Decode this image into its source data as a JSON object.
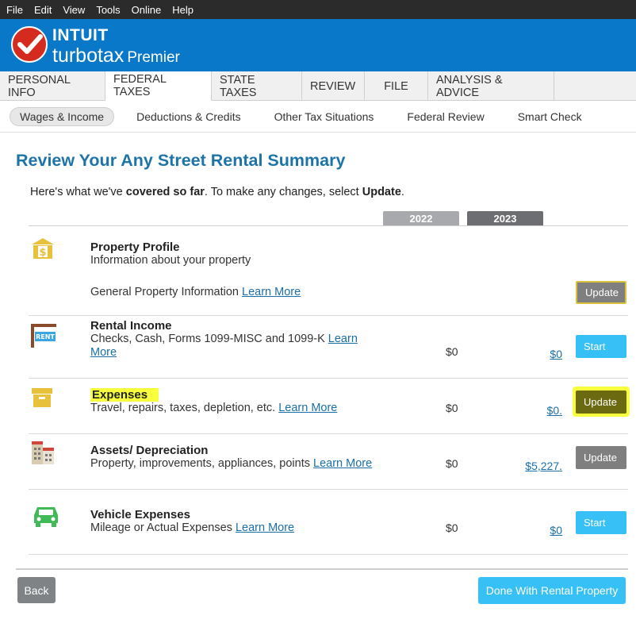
{
  "menu": [
    "File",
    "Edit",
    "View",
    "Tools",
    "Online",
    "Help"
  ],
  "brand": {
    "intuit": "INTUIT",
    "turbotax": "turbotax",
    "edition": "Premier"
  },
  "tabs": [
    "PERSONAL INFO",
    "FEDERAL TAXES",
    "STATE TAXES",
    "REVIEW",
    "FILE",
    "ANALYSIS & ADVICE"
  ],
  "subtabs": [
    "Wages & Income",
    "Deductions & Credits",
    "Other Tax Situations",
    "Federal Review",
    "Smart Check"
  ],
  "page": {
    "title": "Review Your Any Street Rental Summary",
    "intro_pre": "Here's what we've ",
    "intro_bold": "covered so far",
    "intro_mid": ". To make any changes, select ",
    "intro_update": "Update",
    "intro_end": "."
  },
  "years": {
    "prior": "2022",
    "current": "2023"
  },
  "rows": [
    {
      "title": "Property Profile",
      "desc": "Information about your property",
      "sub": "General Property Information",
      "link": "Learn More",
      "button": "Update"
    },
    {
      "title": "Rental Income",
      "desc": "Checks, Cash, Forms 1099-MISC and 1099-K",
      "link": "Learn More",
      "v2022": "$0",
      "v2023": "$0",
      "button": "Start"
    },
    {
      "title": "Expenses",
      "desc": "Travel, repairs, taxes, depletion, etc.",
      "link": "Learn More",
      "v2022": "$0",
      "v2023": "$0.",
      "button": "Update"
    },
    {
      "title": "Assets/ Depreciation",
      "desc": "Property, improvements, appliances, points",
      "link": "Learn More",
      "v2022": "$0",
      "v2023": "$5,227.",
      "button": "Update"
    },
    {
      "title": "Vehicle Expenses",
      "desc": "Mileage or Actual Expenses",
      "link": "Learn More",
      "v2022": "$0",
      "v2023": "$0",
      "button": "Start"
    }
  ],
  "footer": {
    "back": "Back",
    "done": "Done With Rental Property"
  },
  "icons": [
    "property-icon",
    "rent-sign-icon",
    "storage-box-icon",
    "buildings-icon",
    "car-icon",
    "checkmark-icon"
  ],
  "colors": {
    "brand_blue": "#0a78c8",
    "start_button": "#37c0f5",
    "update_button": "#7f7f7f",
    "highlight": "#f8ff3c"
  }
}
